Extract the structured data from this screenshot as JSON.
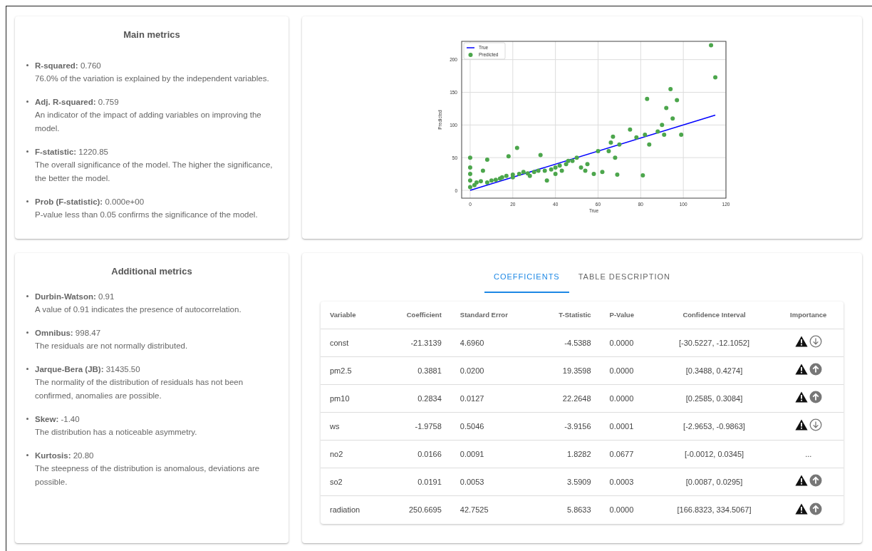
{
  "main_metrics": {
    "title": "Main metrics",
    "items": [
      {
        "text": "**R-squared:** 0.760",
        "description": "76.0% of the variation is explained by the independent variables."
      },
      {
        "text": "**Adj. R-squared:** 0.759",
        "description": "An indicator of the impact of adding variables on improving the model."
      },
      {
        "text": "**F-statistic:** 1220.85",
        "description": "The overall significance of the model. The higher the significance, the better the model."
      },
      {
        "text": "**Prob (F-statistic):** 0.000e+00",
        "description": "P-value less than 0.05 confirms the significance of the model."
      }
    ]
  },
  "plot": {
    "chart_data": {
      "type": "scatter",
      "grid": true,
      "legend": "upper left",
      "xlabel": "True",
      "ylabel": "Predicted",
      "xlim": [
        -4,
        120
      ],
      "ylim": [
        -12,
        228
      ],
      "xticks": [
        0,
        20,
        40,
        60,
        80,
        100,
        120
      ],
      "yticks": [
        0,
        50,
        100,
        150,
        200
      ],
      "series": [
        {
          "name": "True",
          "color": "#0000ff",
          "type": "line",
          "x": [
            0,
            115
          ],
          "values": [
            0,
            115
          ]
        },
        {
          "name": "Predicted",
          "color": "#4ca64c",
          "x": [
            0,
            0,
            0,
            0,
            0,
            2,
            3,
            5,
            6,
            8,
            8,
            10,
            12,
            14,
            15,
            17,
            18,
            20,
            20,
            22,
            23,
            25,
            27,
            28,
            30,
            32,
            33,
            35,
            36,
            38,
            40,
            40,
            42,
            43,
            45,
            46,
            48,
            50,
            52,
            54,
            55,
            58,
            60,
            62,
            65,
            66,
            67,
            68,
            69,
            70,
            75,
            78,
            81,
            82,
            83,
            84,
            88,
            90,
            91,
            92,
            94,
            95,
            97,
            99,
            113,
            115
          ],
          "values": [
            5,
            15,
            25,
            35,
            50,
            8,
            12,
            14,
            30,
            47,
            12,
            15,
            16,
            18,
            20,
            22,
            52,
            24,
            20,
            65,
            25,
            28,
            26,
            22,
            28,
            30,
            54,
            30,
            15,
            32,
            35,
            25,
            38,
            30,
            40,
            45,
            45,
            50,
            35,
            30,
            40,
            25,
            60,
            28,
            60,
            73,
            82,
            50,
            24,
            70,
            93,
            81,
            23,
            85,
            140,
            70,
            90,
            100,
            85,
            126,
            155,
            110,
            138,
            85,
            222,
            173
          ]
        }
      ]
    }
  },
  "additional_metrics": {
    "title": "Additional metrics",
    "items": [
      {
        "text": "**Durbin-Watson:** 0.91",
        "description": "A value of 0.91 indicates the presence of autocorrelation."
      },
      {
        "text": "**Omnibus:** 998.47",
        "description": "The residuals are not normally distributed."
      },
      {
        "text": "**Jarque-Bera (JB):** 31435.50",
        "description": "The normality of the distribution of residuals has not been confirmed, anomalies are possible."
      },
      {
        "text": "**Skew:** -1.40",
        "description": "The distribution has a noticeable asymmetry."
      },
      {
        "text": "**Kurtosis:** 20.80",
        "description": "The steepness of the distribution is anomalous, deviations are possible."
      }
    ]
  },
  "tabs": [
    {
      "label": "COEFFICIENTS",
      "selected": true
    },
    {
      "label": "TABLE DESCRIPTION",
      "selected": false
    }
  ],
  "table": {
    "columns": [
      "Variable",
      "Coefficient",
      "Standard Error",
      "T-Statistic",
      "P-Value",
      "Confidence Interval",
      "Importance"
    ],
    "rows": [
      {
        "cells": [
          "const",
          "-21.3139",
          "4.6960",
          "-4.5388",
          "0.0000",
          "[-30.5227, -12.1052]"
        ],
        "importance": {
          "kind": "down",
          "warning": true
        }
      },
      {
        "cells": [
          "pm2.5",
          "0.3881",
          "0.0200",
          "19.3598",
          "0.0000",
          "[0.3488, 0.4274]"
        ],
        "importance": {
          "kind": "up",
          "warning": true
        }
      },
      {
        "cells": [
          "pm10",
          "0.2834",
          "0.0127",
          "22.2648",
          "0.0000",
          "[0.2585, 0.3084]"
        ],
        "importance": {
          "kind": "up",
          "warning": true
        }
      },
      {
        "cells": [
          "ws",
          "-1.9758",
          "0.5046",
          "-3.9156",
          "0.0001",
          "[-2.9653, -0.9863]"
        ],
        "importance": {
          "kind": "down",
          "warning": true
        }
      },
      {
        "cells": [
          "no2",
          "0.0166",
          "0.0091",
          "1.8282",
          "0.0677",
          "[-0.0012, 0.0345]"
        ],
        "importance": {
          "kind": "text",
          "text": "..."
        }
      },
      {
        "cells": [
          "so2",
          "0.0191",
          "0.0053",
          "3.5909",
          "0.0003",
          "[0.0087, 0.0295]"
        ],
        "importance": {
          "kind": "up",
          "warning": true
        }
      },
      {
        "cells": [
          "radiation",
          "250.6695",
          "42.7525",
          "5.8633",
          "0.0000",
          "[166.8323, 334.5067]"
        ],
        "importance": {
          "kind": "up",
          "warning": true
        }
      }
    ]
  }
}
